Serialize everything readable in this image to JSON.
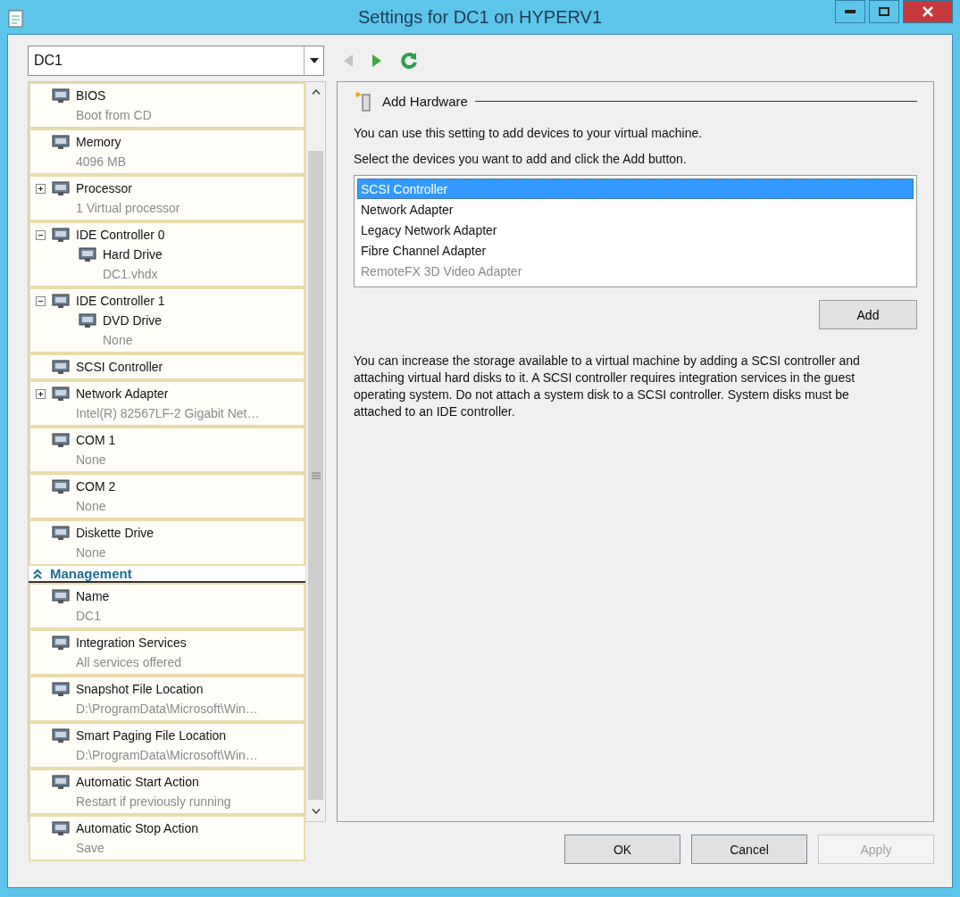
{
  "window": {
    "title": "Settings for DC1 on HYPERV1"
  },
  "vm_selector": {
    "value": "DC1"
  },
  "toolbar": [
    {
      "kind": "back",
      "disabled": true
    },
    {
      "kind": "forward",
      "disabled": false
    },
    {
      "kind": "refresh",
      "disabled": false
    }
  ],
  "sidebar": {
    "hardware": [
      {
        "label": "BIOS",
        "detail": "Boot from CD"
      },
      {
        "label": "Memory",
        "detail": "4096 MB"
      },
      {
        "label": "Processor",
        "detail": "1 Virtual processor",
        "expanded": false
      },
      {
        "label": "IDE Controller 0",
        "expanded": true,
        "children": [
          {
            "label": "Hard Drive",
            "detail": "DC1.vhdx"
          }
        ]
      },
      {
        "label": "IDE Controller 1",
        "expanded": true,
        "children": [
          {
            "label": "DVD Drive",
            "detail": "None"
          }
        ]
      },
      {
        "label": "SCSI Controller"
      },
      {
        "label": "Network Adapter",
        "detail": "Intel(R) 82567LF-2 Gigabit Net…",
        "expanded": false
      },
      {
        "label": "COM 1",
        "detail": "None"
      },
      {
        "label": "COM 2",
        "detail": "None"
      },
      {
        "label": "Diskette Drive",
        "detail": "None"
      }
    ],
    "management": {
      "title": "Management",
      "expanded": true,
      "items": [
        {
          "label": "Name",
          "detail": "DC1"
        },
        {
          "label": "Integration Services",
          "detail": "All services offered"
        },
        {
          "label": "Snapshot File Location",
          "detail": "D:\\ProgramData\\Microsoft\\Win…"
        },
        {
          "label": "Smart Paging File Location",
          "detail": "D:\\ProgramData\\Microsoft\\Win…"
        },
        {
          "label": "Automatic Start Action",
          "detail": "Restart if previously running"
        },
        {
          "label": "Automatic Stop Action",
          "detail": "Save"
        }
      ]
    }
  },
  "panel": {
    "title": "Add Hardware",
    "intro": "You can use this setting to add devices to your virtual machine.",
    "prompt": "Select the devices you want to add and click the Add button.",
    "devices": [
      {
        "label": "SCSI Controller",
        "selected": true,
        "disabled": false
      },
      {
        "label": "Network Adapter",
        "selected": false,
        "disabled": false
      },
      {
        "label": "Legacy Network Adapter",
        "selected": false,
        "disabled": false
      },
      {
        "label": "Fibre Channel Adapter",
        "selected": false,
        "disabled": false
      },
      {
        "label": "RemoteFX 3D Video Adapter",
        "selected": false,
        "disabled": true
      }
    ],
    "add_button": "Add",
    "note": "You can increase the storage available to a virtual machine by adding a SCSI controller and attaching virtual hard disks to it. A SCSI controller requires integration services in the guest operating system. Do not attach a system disk to a SCSI controller. System disks must be attached to an IDE controller."
  },
  "buttons": [
    {
      "label": "OK",
      "disabled": false
    },
    {
      "label": "Cancel",
      "disabled": false
    },
    {
      "label": "Apply",
      "disabled": true
    }
  ]
}
